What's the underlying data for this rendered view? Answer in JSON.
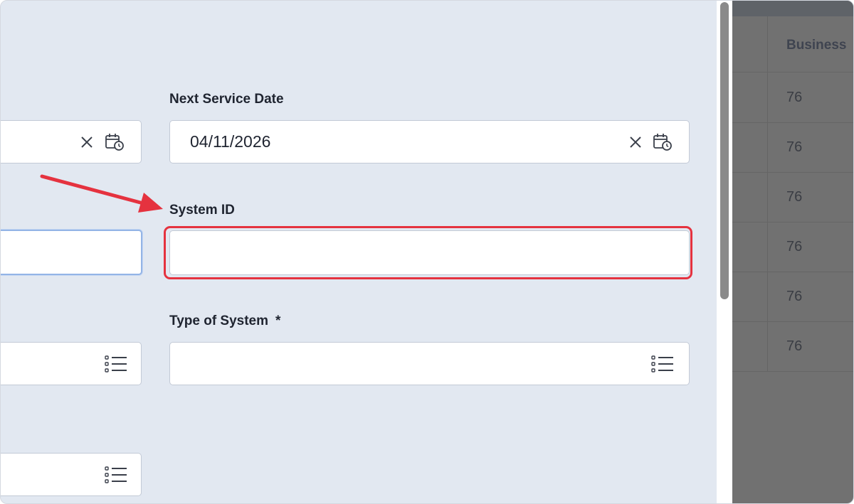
{
  "table": {
    "header": "Business",
    "rows": [
      "76",
      "76",
      "76",
      "76",
      "76",
      "76"
    ]
  },
  "form": {
    "next_service_date": {
      "label": "Next Service Date",
      "value": "04/11/2026"
    },
    "system_id": {
      "label": "System ID",
      "value": ""
    },
    "type_of_system": {
      "label": "Type of System",
      "required_mark": "*",
      "value": ""
    }
  },
  "icons": {
    "clear": "close-icon",
    "calendar": "calendar-clock-icon",
    "list": "list-icon"
  },
  "colors": {
    "panel_bg": "#e2e8f1",
    "annotation_red": "#e5323f",
    "focus_blue": "#93b4e6"
  }
}
